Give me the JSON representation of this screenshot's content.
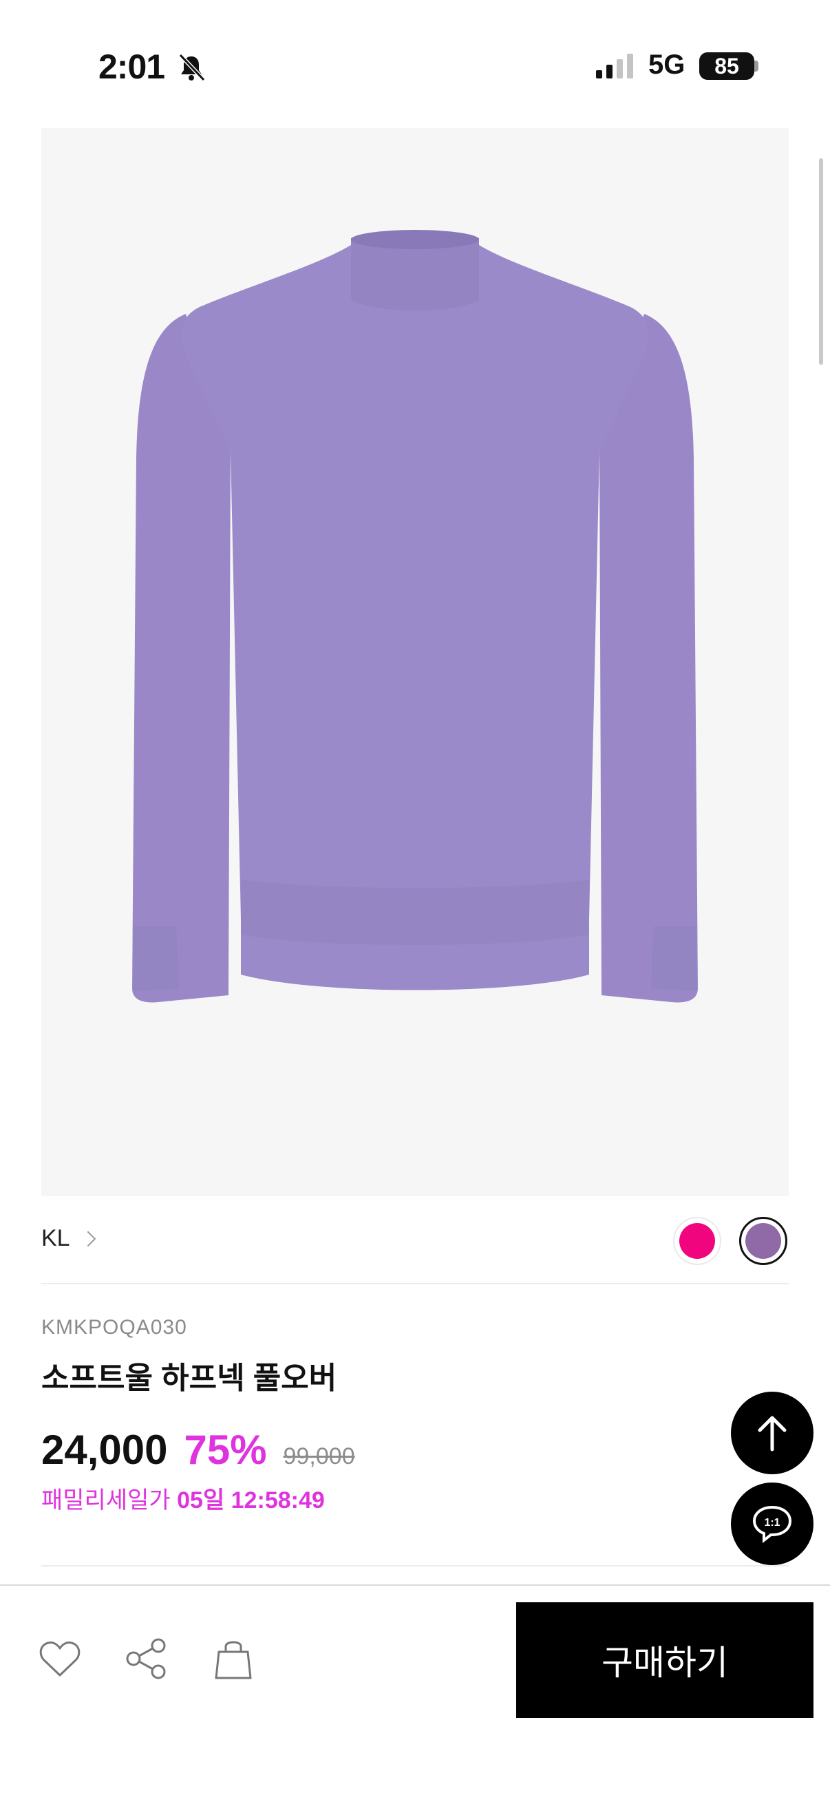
{
  "status_bar": {
    "time": "2:01",
    "network": "5G",
    "battery": "85"
  },
  "product": {
    "brand": "KL",
    "code": "KMKPOQA030",
    "name": "소프트울 하프넥 풀오버",
    "price": "24,000",
    "discount": "75%",
    "original_price": "99,000",
    "sale_label": "패밀리세일가",
    "sale_timer": "05일 12:58:49",
    "colors": [
      "#f0057f",
      "#8f6aa6"
    ]
  },
  "fab": {
    "chat_label": "1:1"
  },
  "bottom_bar": {
    "buy_label": "구매하기"
  }
}
